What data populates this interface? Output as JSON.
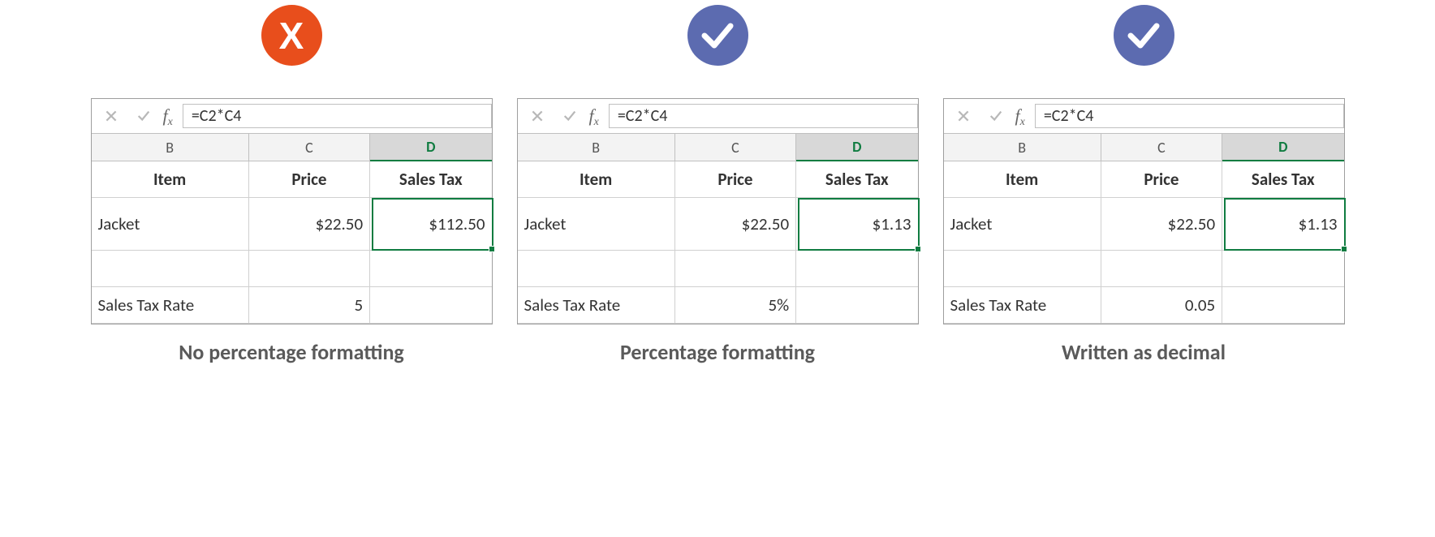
{
  "panels": [
    {
      "badge": {
        "type": "x",
        "glyph": "X",
        "color": "#E84E1C"
      },
      "formula": "=C2*C4",
      "columns": {
        "b": "B",
        "c": "C",
        "d": "D"
      },
      "headers": {
        "item": "Item",
        "price": "Price",
        "salestax": "Sales Tax"
      },
      "row1": {
        "item": "Jacket",
        "price": "$22.50",
        "salestax": "$112.50"
      },
      "row3": {
        "label": "Sales Tax Rate",
        "value": "5"
      },
      "caption": "No percentage formatting"
    },
    {
      "badge": {
        "type": "check",
        "color": "#5C6BB0"
      },
      "formula": "=C2*C4",
      "columns": {
        "b": "B",
        "c": "C",
        "d": "D"
      },
      "headers": {
        "item": "Item",
        "price": "Price",
        "salestax": "Sales Tax"
      },
      "row1": {
        "item": "Jacket",
        "price": "$22.50",
        "salestax": "$1.13"
      },
      "row3": {
        "label": "Sales Tax Rate",
        "value": "5%"
      },
      "caption": "Percentage formatting"
    },
    {
      "badge": {
        "type": "check",
        "color": "#5C6BB0"
      },
      "formula": "=C2*C4",
      "columns": {
        "b": "B",
        "c": "C",
        "d": "D"
      },
      "headers": {
        "item": "Item",
        "price": "Price",
        "salestax": "Sales Tax"
      },
      "row1": {
        "item": "Jacket",
        "price": "$22.50",
        "salestax": "$1.13"
      },
      "row3": {
        "label": "Sales Tax Rate",
        "value": "0.05"
      },
      "caption": "Written as decimal"
    }
  ]
}
